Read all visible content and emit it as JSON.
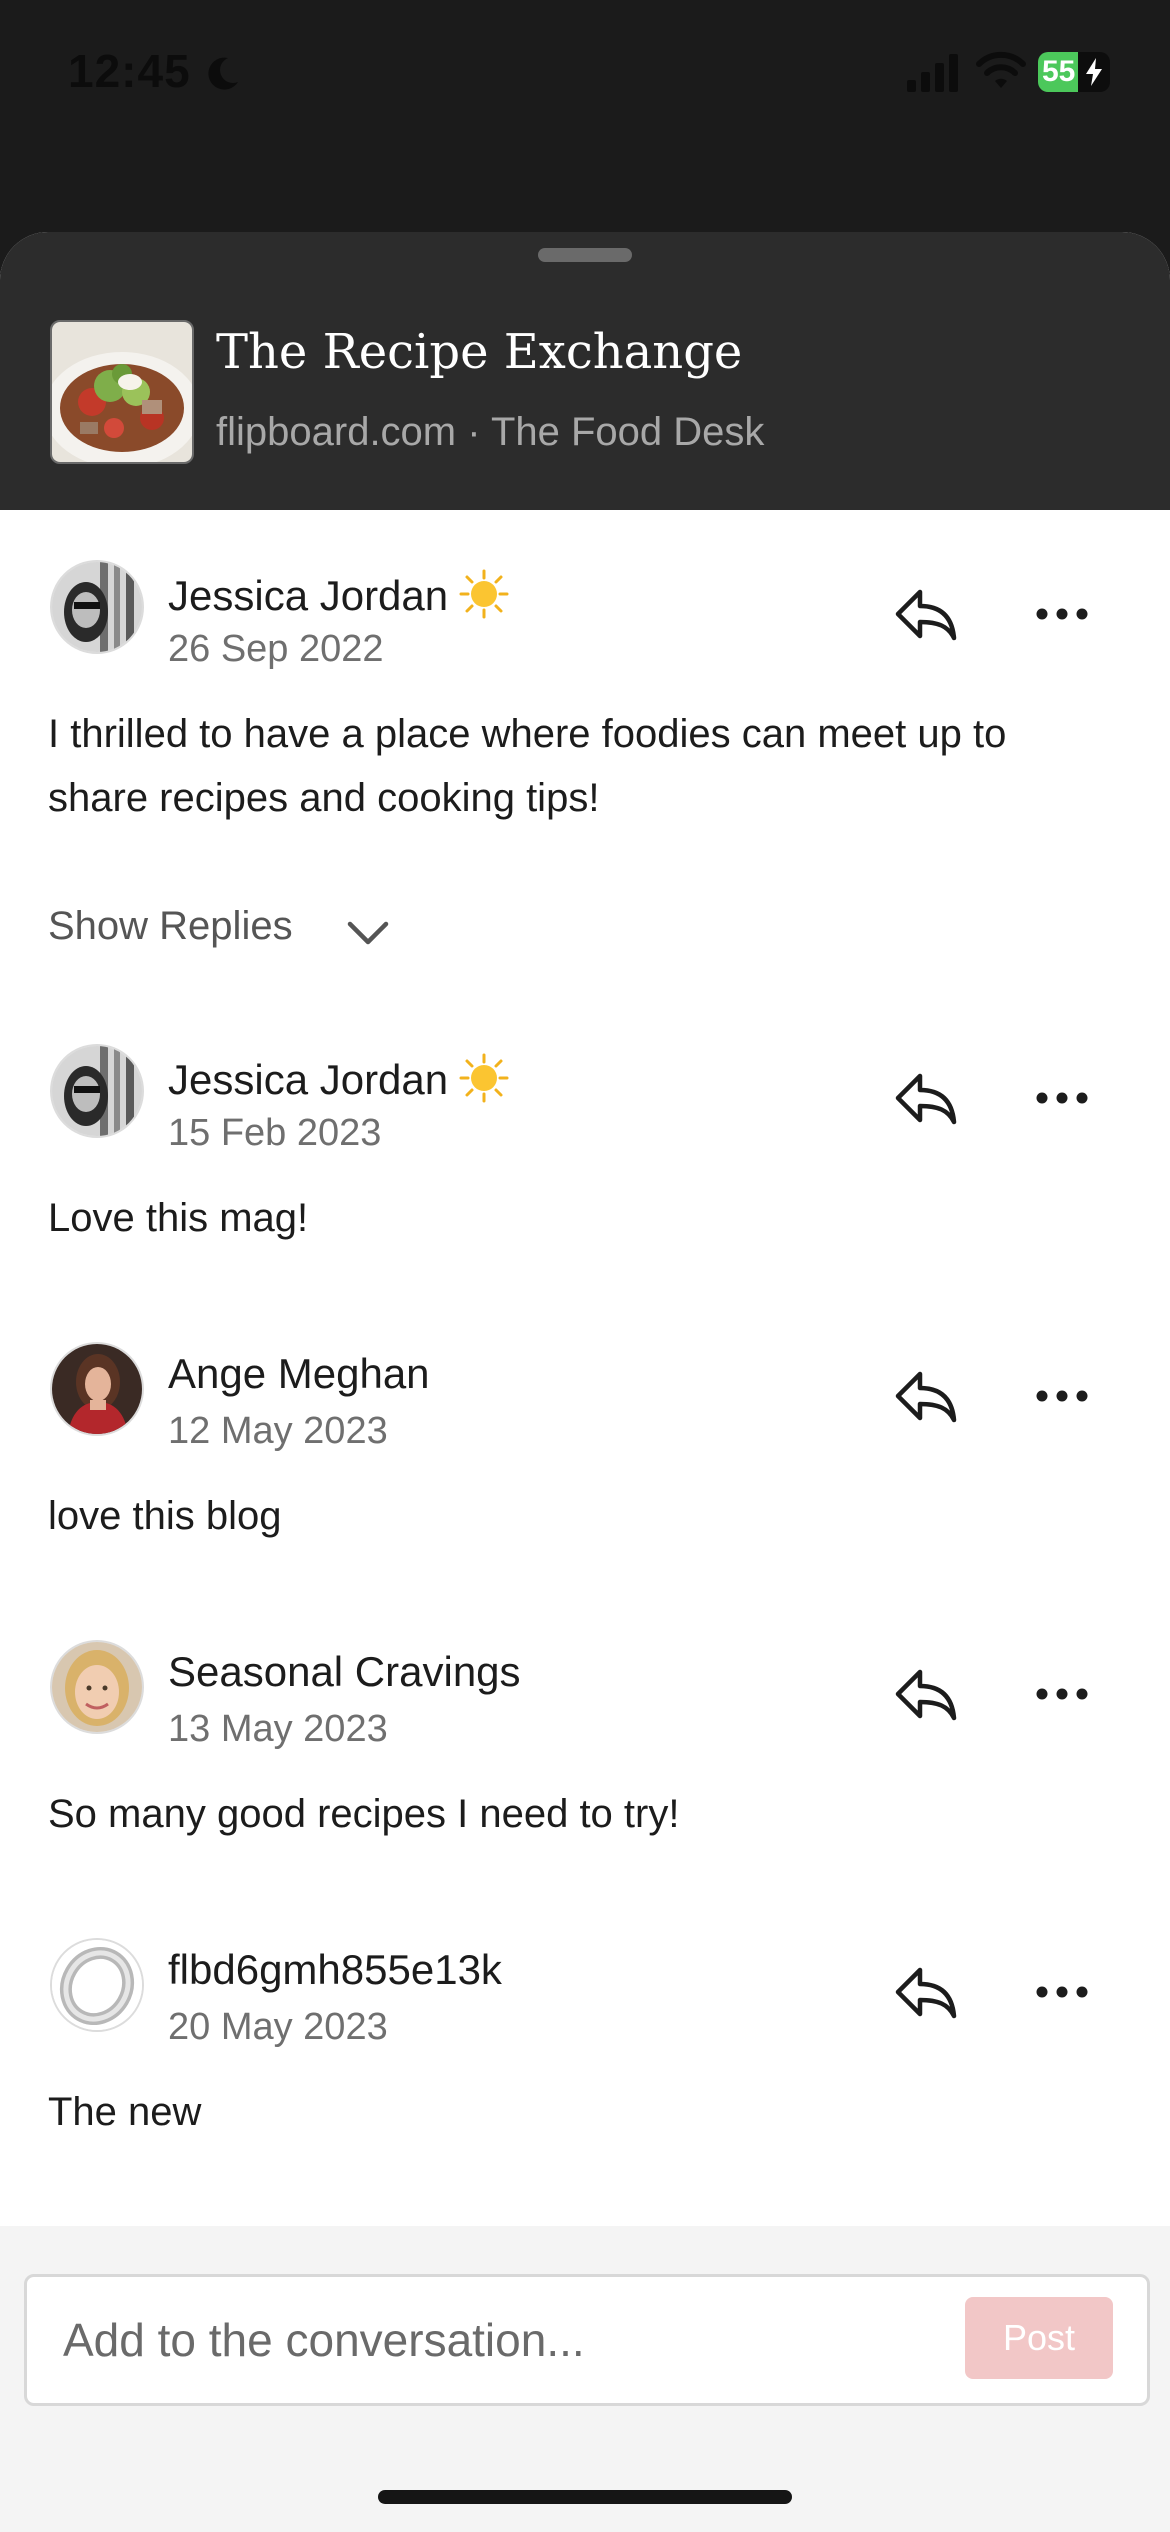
{
  "status_bar": {
    "time": "12:45",
    "battery": "55",
    "battery_level": 0.55
  },
  "header": {
    "title": "The Recipe Exchange",
    "subtitle": "flipboard.com · The Food Desk"
  },
  "show_replies_label": "Show Replies",
  "comments": [
    {
      "author": "Jessica Jordan",
      "date": "26 Sep 2022",
      "text": "I thrilled to have a place where foodies can meet up to share recipes and cooking tips!"
    },
    {
      "author": "Jessica Jordan",
      "date": "15 Feb 2023",
      "text": "Love this mag!"
    },
    {
      "author": "Ange Meghan",
      "date": "12 May 2023",
      "text": "love this blog"
    },
    {
      "author": "Seasonal Cravings",
      "date": "13 May 2023",
      "text": "So many good recipes I need to try!"
    },
    {
      "author": "flbd6gmh855e13k",
      "date": "20 May 2023",
      "text": "The new"
    }
  ],
  "composer": {
    "placeholder": "Add to the conversation...",
    "post_label": "Post"
  },
  "colors": {
    "accent_disabled": "#f2c7c7",
    "battery_green": "#4cc85b"
  }
}
